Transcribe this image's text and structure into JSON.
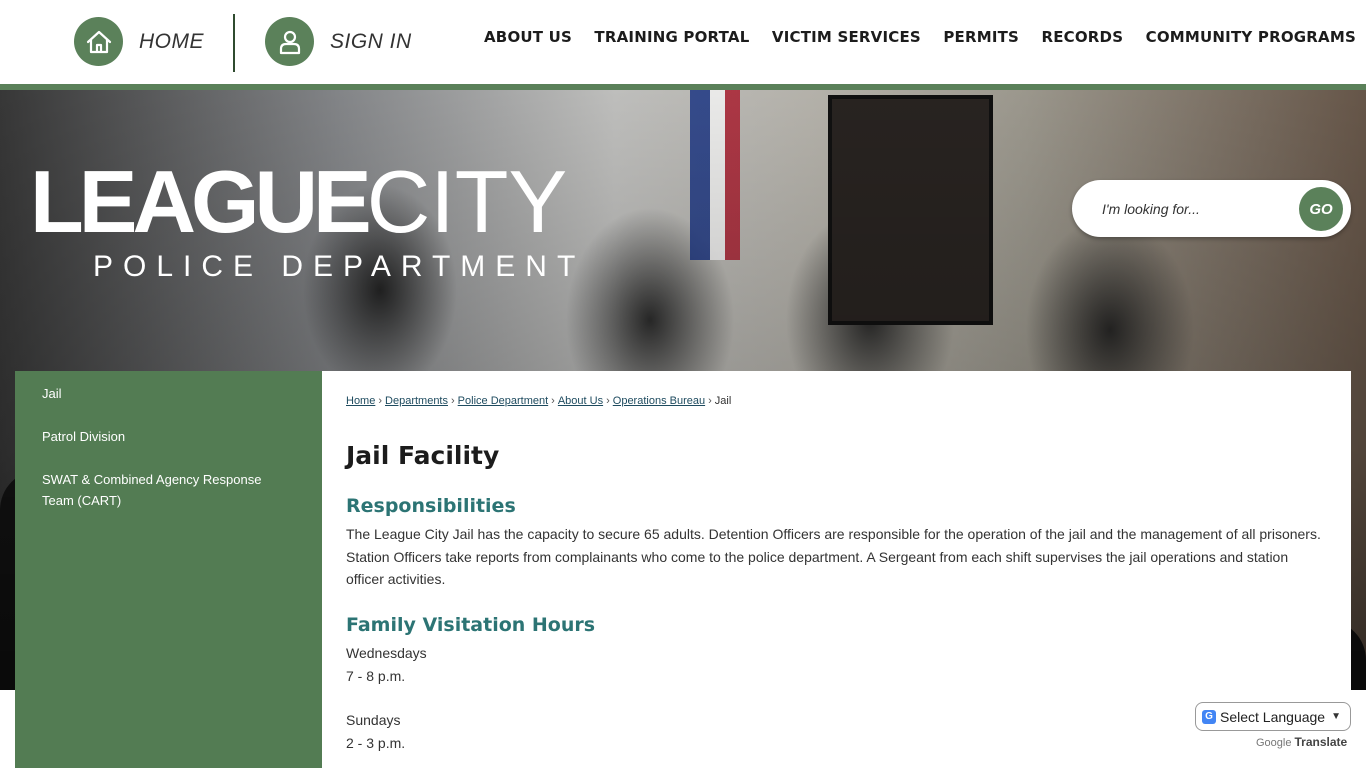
{
  "header": {
    "home_label": "HOME",
    "signin_label": "SIGN IN",
    "nav": [
      "ABOUT US",
      "TRAINING PORTAL",
      "VICTIM SERVICES",
      "PERMITS",
      "RECORDS",
      "COMMUNITY PROGRAMS"
    ]
  },
  "hero": {
    "logo_word1": "LEAGUE",
    "logo_word2": "CITY",
    "logo_sub": "POLICE DEPARTMENT"
  },
  "search": {
    "placeholder": "I'm looking for...",
    "go_label": "GO"
  },
  "sidebar": {
    "items": [
      "Jail",
      "Patrol Division",
      "SWAT & Combined Agency Response Team (CART)"
    ]
  },
  "breadcrumb": {
    "items": [
      "Home",
      "Departments",
      "Police Department",
      "About Us",
      "Operations Bureau"
    ],
    "current": "Jail",
    "separator": "›"
  },
  "main": {
    "title": "Jail Facility",
    "responsibilities_heading": "Responsibilities",
    "responsibilities_text": "The League City Jail has the capacity to secure 65 adults. Detention Officers are responsible for the operation of the jail and the management of all prisoners. Station Officers take reports from complainants who come to the police department.  A Sergeant from each shift supervises the jail operations and station officer activities.",
    "visitation_heading": "Family Visitation Hours",
    "visitation": [
      {
        "day": "Wednesdays",
        "time": "7 - 8 p.m."
      },
      {
        "day": "Sundays",
        "time": "2 - 3 p.m."
      }
    ]
  },
  "translate": {
    "select_label": "Select Language",
    "powered_by": "Google",
    "translate_label": "Translate"
  },
  "colors": {
    "brand_green": "#5b815a",
    "sidebar_green": "#537c53",
    "heading_teal": "#2c7474"
  },
  "icons": {
    "home": "home-icon",
    "signin": "user-icon"
  }
}
